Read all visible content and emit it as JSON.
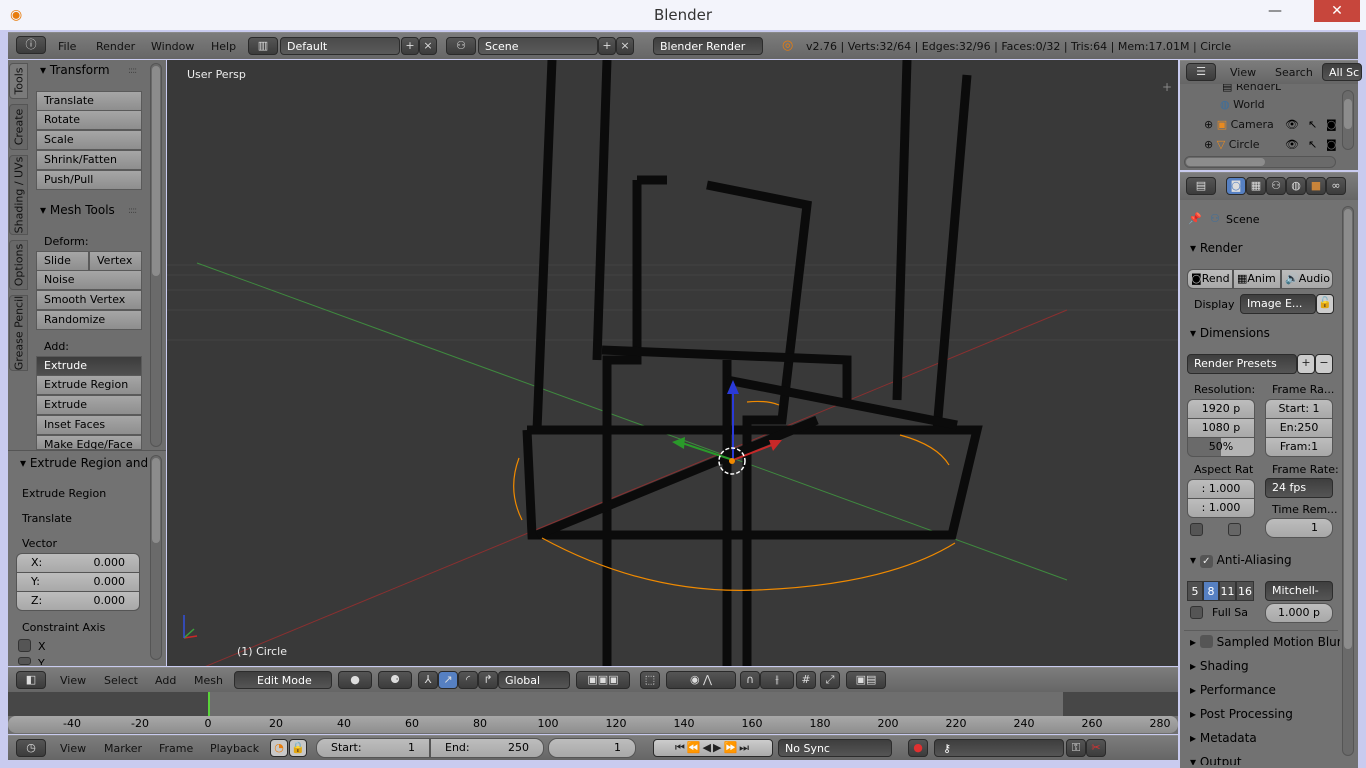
{
  "window": {
    "title": "Blender",
    "minimize": "—",
    "maximize": "☐",
    "close": "✕"
  },
  "info_header": {
    "menus": [
      "File",
      "Render",
      "Window",
      "Help"
    ],
    "layout": "Default",
    "scene": "Scene",
    "engine": "Blender Render",
    "stats": "v2.76 | Verts:32/64 | Edges:32/96 | Faces:0/32 | Tris:64 | Mem:17.01M | Circle"
  },
  "toolshelf": {
    "tabs": [
      "Tools",
      "Create",
      "Shading / UVs",
      "Options",
      "Grease Pencil"
    ],
    "transform": {
      "title": "Transform",
      "buttons": [
        "Translate",
        "Rotate",
        "Scale",
        "Shrink/Fatten",
        "Push/Pull"
      ]
    },
    "mesh_tools": {
      "title": "Mesh Tools",
      "deform_label": "Deform:",
      "slide": "Slide Ed",
      "vertex": "Vertex",
      "deform_buttons": [
        "Noise",
        "Smooth Vertex",
        "Randomize"
      ],
      "add_label": "Add:",
      "extrude": "Extrude",
      "add_buttons": [
        "Extrude Region",
        "Extrude Individual",
        "Inset Faces",
        "Make Edge/Face"
      ]
    }
  },
  "operator": {
    "title": "Extrude Region and",
    "items": [
      "Extrude Region",
      "Translate"
    ],
    "vector_label": "Vector",
    "x_label": "X:",
    "x": "0.000",
    "y_label": "Y:",
    "y": "0.000",
    "z_label": "Z:",
    "z": "0.000",
    "constraint_label": "Constraint Axis",
    "axis_x": "X",
    "axis_y": "Y"
  },
  "viewport": {
    "view_name": "User Persp",
    "object_label": "(1) Circle",
    "axis_labels": {
      "x": "x",
      "y": "y",
      "z": "z"
    }
  },
  "view3d_header": {
    "menus": [
      "View",
      "Select",
      "Add",
      "Mesh"
    ],
    "mode": "Edit Mode",
    "orientation": "Global"
  },
  "timeline": {
    "ticks": [
      -40,
      -20,
      0,
      20,
      40,
      60,
      80,
      100,
      120,
      140,
      160,
      180,
      200,
      220,
      240,
      260,
      280
    ],
    "current_frame": 0,
    "menus": [
      "View",
      "Marker",
      "Frame",
      "Playback"
    ],
    "start_label": "Start:",
    "start": "1",
    "end_label": "End:",
    "end": "250",
    "frame": "1",
    "sync": "No Sync"
  },
  "outliner": {
    "menus": [
      "View",
      "Search"
    ],
    "filter": "All Sc",
    "items": [
      "RenderL",
      "World",
      "Camera",
      "Circle"
    ]
  },
  "properties": {
    "context": "Scene",
    "render": {
      "title": "Render",
      "buttons": [
        "Rend",
        "Anim",
        "Audio"
      ],
      "display_label": "Display",
      "display": "Image E..."
    },
    "dimensions": {
      "title": "Dimensions",
      "presets": "Render Presets",
      "resolution_label": "Resolution:",
      "res_x": "1920 p",
      "res_y": "1080 p",
      "res_pct": "50%",
      "res_pct_value": 50,
      "frame_range_label": "Frame Ra...",
      "start": "Start: 1",
      "end": "En:250",
      "step": "Fram:1",
      "aspect_label": "Aspect Rat",
      "aspect_x": ": 1.000",
      "aspect_y": ": 1.000",
      "frame_rate_label": "Frame Rate:",
      "fps": "24 fps",
      "time_remap_label": "Time Rem...",
      "time_remap": "1"
    },
    "anti_aliasing": {
      "title": "Anti-Aliasing",
      "samples": [
        "5",
        "8",
        "11",
        "16"
      ],
      "selected": "8",
      "filter": "Mitchell-",
      "full_sample": "Full Sa",
      "size": "1.000 p"
    },
    "collapsed": [
      "Sampled Motion Blur",
      "Shading",
      "Performance",
      "Post Processing",
      "Metadata",
      "Output"
    ]
  },
  "colors": {
    "accent": "#5680c2",
    "viewport_bg": "#393939",
    "panel": "#727272",
    "selected_vertex": "#f08a00",
    "x_axis": "#c83232",
    "y_axis": "#3ca03c",
    "z_axis": "#3250dc"
  }
}
